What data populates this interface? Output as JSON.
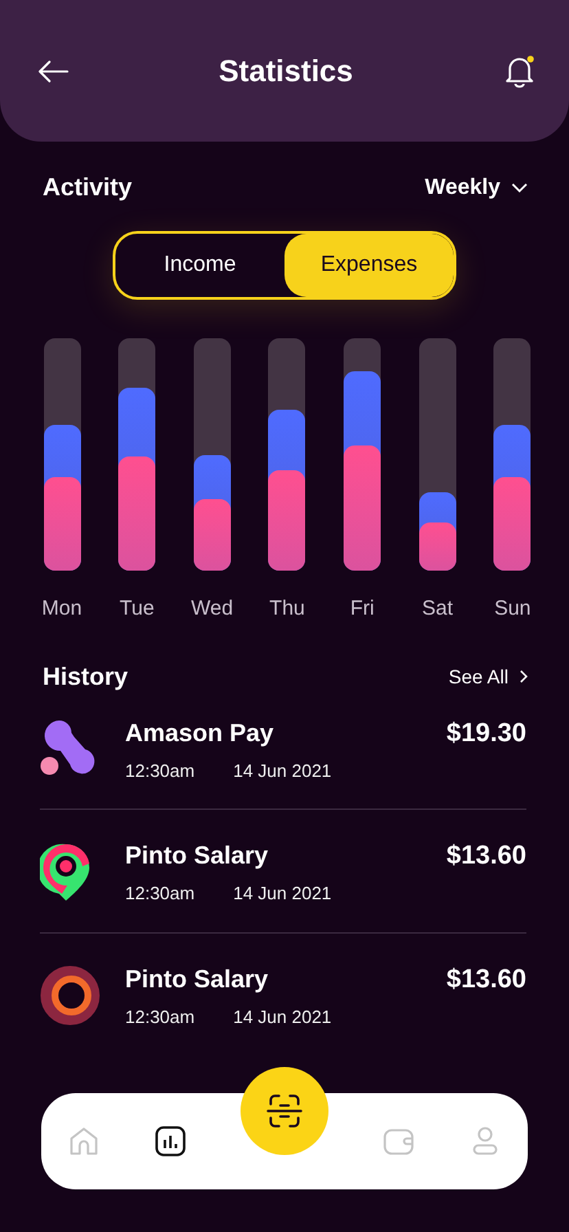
{
  "header": {
    "title": "Statistics",
    "notification_dot": true
  },
  "activity": {
    "title": "Activity",
    "period": "Weekly",
    "tabs": [
      {
        "label": "Income",
        "selected": false
      },
      {
        "label": "Expenses",
        "selected": true
      }
    ],
    "days": [
      {
        "label": "Mon",
        "segments": [
          {
            "color": "#4f6bff",
            "level": 0.63
          },
          {
            "color": "#ff4f8f",
            "level": 0.4
          }
        ]
      },
      {
        "label": "Tue",
        "segments": [
          {
            "color": "#4f6bff",
            "level": 0.79
          },
          {
            "color": "#ff4f8f",
            "level": 0.49
          }
        ]
      },
      {
        "label": "Wed",
        "segments": [
          {
            "color": "#4f6bff",
            "level": 0.5
          },
          {
            "color": "#ff4f8f",
            "level": 0.31
          }
        ]
      },
      {
        "label": "Thu",
        "segments": [
          {
            "color": "#4f6bff",
            "level": 0.69
          },
          {
            "color": "#ff4f8f",
            "level": 0.43
          }
        ]
      },
      {
        "label": "Fri",
        "segments": [
          {
            "color": "#4f6bff",
            "level": 0.86
          },
          {
            "color": "#ff4f8f",
            "level": 0.54
          }
        ]
      },
      {
        "label": "Sat",
        "segments": [
          {
            "color": "#4f6bff",
            "level": 0.34
          },
          {
            "color": "#ff4f8f",
            "level": 0.21
          }
        ]
      },
      {
        "label": "Sun",
        "segments": [
          {
            "color": "#4f6bff",
            "level": 0.63
          },
          {
            "color": "#ff4f8f",
            "level": 0.4
          }
        ]
      }
    ]
  },
  "history": {
    "title": "History",
    "link": "See All",
    "items": [
      {
        "kind": "blobs",
        "name": "Amason Pay",
        "time": "12:30am",
        "date": "14 Jun 2021",
        "amount": "$19.30"
      },
      {
        "kind": "pin",
        "name": "Pinto Salary",
        "time": "12:30am",
        "date": "14 Jun 2021",
        "amount": "$13.60"
      },
      {
        "kind": "ring",
        "name": "Pinto Salary",
        "time": "12:30am",
        "date": "14 Jun 2021",
        "amount": "$13.60"
      }
    ]
  },
  "nav": [
    {
      "kind": "home",
      "selected": false
    },
    {
      "kind": "stats",
      "selected": true
    },
    {
      "kind": "scan",
      "selected": false
    },
    {
      "kind": "wallet",
      "selected": false
    },
    {
      "kind": "profile",
      "selected": false
    }
  ]
}
